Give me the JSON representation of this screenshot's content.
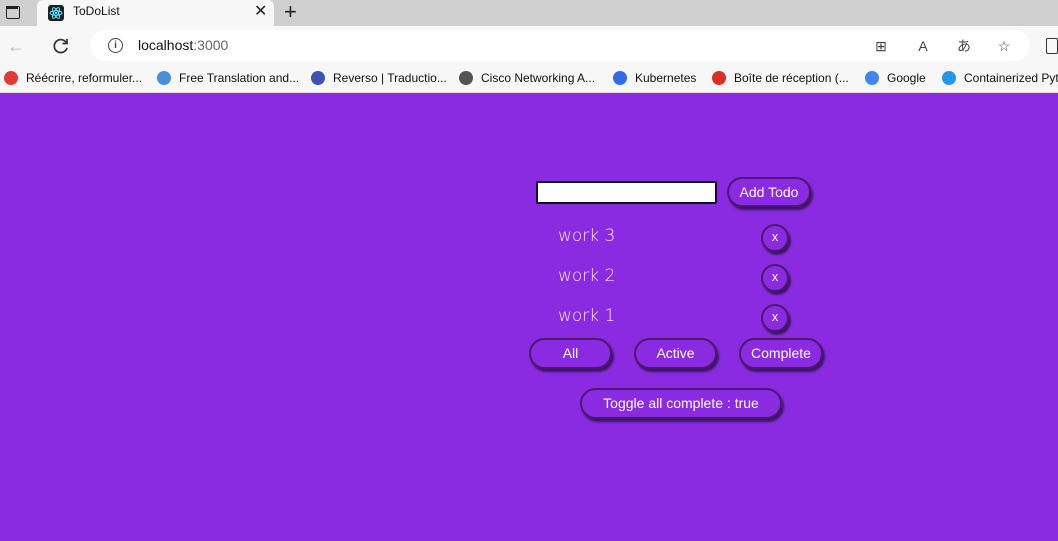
{
  "browser": {
    "tab": {
      "title": "ToDoList",
      "close_label": "✕"
    },
    "new_tab_label": "+",
    "url": {
      "host": "localhost",
      "port": ":3000"
    },
    "bookmarks": [
      {
        "label": "Réécrire, reformuler...",
        "color": "#e53935"
      },
      {
        "label": "Free Translation and...",
        "color": "#4a90d9"
      },
      {
        "label": "Reverso | Traductio...",
        "color": "#3f51b5"
      },
      {
        "label": "Cisco Networking A...",
        "color": "#555555"
      },
      {
        "label": "Kubernetes",
        "color": "#326ce5"
      },
      {
        "label": "Boîte de réception (...",
        "color": "#d93025"
      },
      {
        "label": "Google",
        "color": "#4285f4"
      },
      {
        "label": "Containerized Pyt",
        "color": "#2496ed"
      }
    ]
  },
  "app": {
    "input": {
      "value": "",
      "placeholder": ""
    },
    "add_button_label": "Add Todo",
    "todos": [
      {
        "text": "work 3",
        "delete_label": "x"
      },
      {
        "text": "work 2",
        "delete_label": "x"
      },
      {
        "text": "work 1",
        "delete_label": "x"
      }
    ],
    "filters": {
      "all": "All",
      "active": "Active",
      "complete": "Complete"
    },
    "toggle_label": "Toggle all complete : true",
    "colors": {
      "background": "#8a2be2",
      "button_border": "#4a1a6e"
    }
  }
}
